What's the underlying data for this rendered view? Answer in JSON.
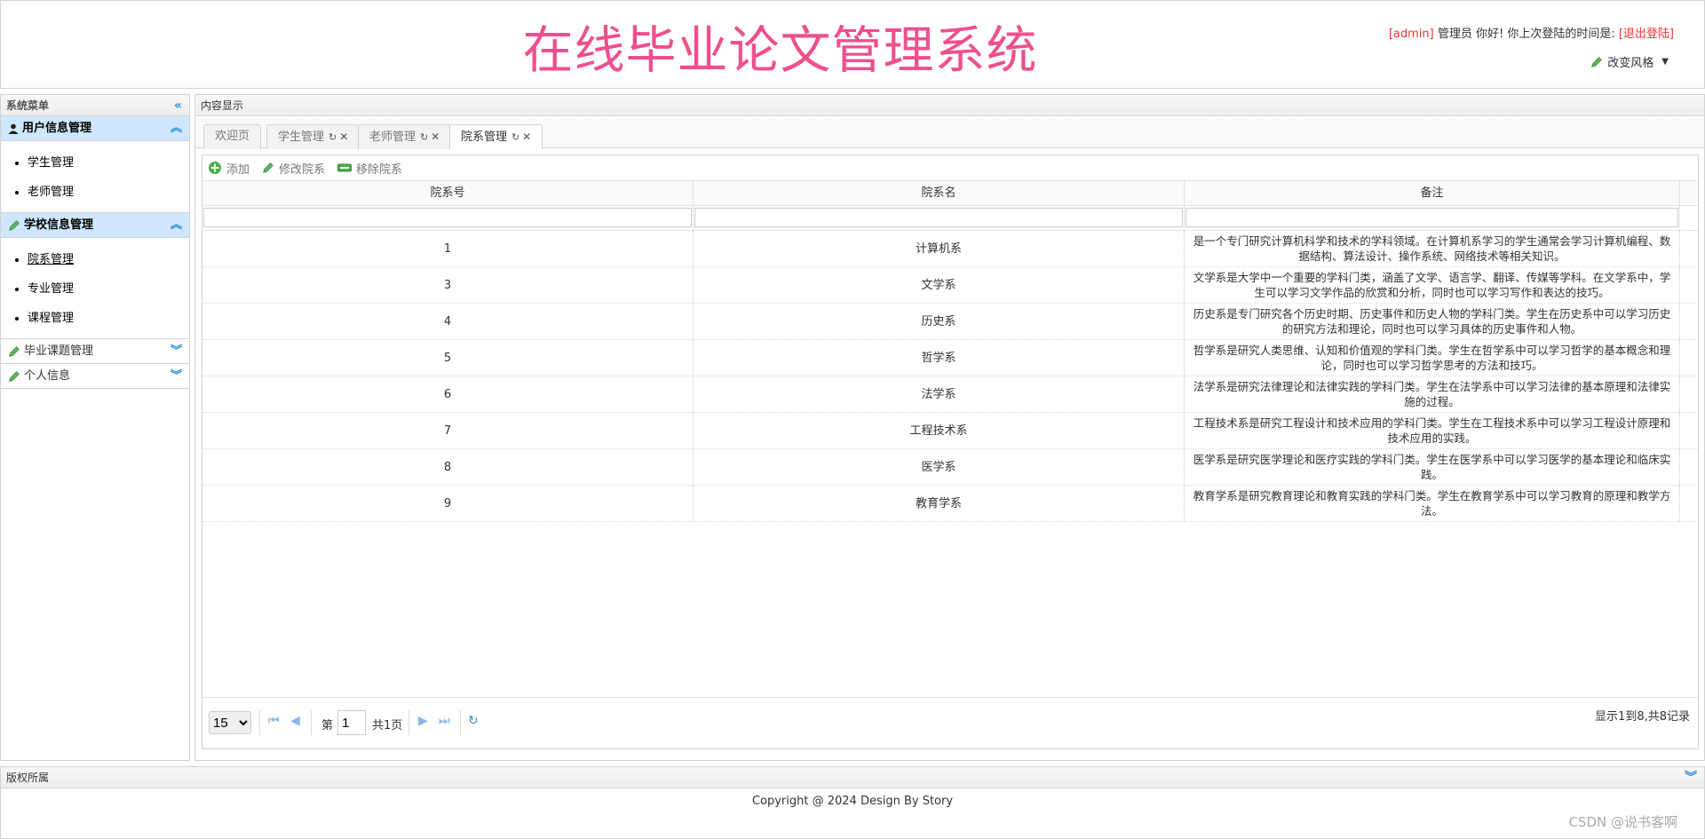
{
  "header": {
    "title": "在线毕业论文管理系统",
    "user_bracket": "[admin]",
    "role_greeting": " 管理员 你好! 你上次登陆的时间是: ",
    "logout": "[退出登陆]",
    "style_switch": "改变风格"
  },
  "west": {
    "title": "系统菜单",
    "groups": [
      {
        "label": "用户信息管理",
        "items": [
          "学生管理",
          "老师管理"
        ]
      },
      {
        "label": "学校信息管理",
        "items": [
          "院系管理",
          "专业管理",
          "课程管理"
        ]
      },
      {
        "label": "毕业课题管理"
      },
      {
        "label": "个人信息"
      }
    ]
  },
  "center": {
    "title": "内容显示",
    "tabs": [
      "欢迎页",
      "学生管理",
      "老师管理",
      "院系管理"
    ],
    "toolbar": {
      "add": "添加",
      "edit": "修改院系",
      "remove": "移除院系"
    },
    "columns": [
      "院系号",
      "院系名",
      "备注"
    ],
    "rows": [
      {
        "id": "1",
        "name": "计算机系",
        "note": "是一个专门研究计算机科学和技术的学科领域。在计算机系学习的学生通常会学习计算机编程、数据结构、算法设计、操作系统、网络技术等相关知识。"
      },
      {
        "id": "3",
        "name": "文学系",
        "note": "文学系是大学中一个重要的学科门类，涵盖了文学、语言学、翻译、传媒等学科。在文学系中，学生可以学习文学作品的欣赏和分析，同时也可以学习写作和表达的技巧。"
      },
      {
        "id": "4",
        "name": "历史系",
        "note": "历史系是专门研究各个历史时期、历史事件和历史人物的学科门类。学生在历史系中可以学习历史的研究方法和理论，同时也可以学习具体的历史事件和人物。"
      },
      {
        "id": "5",
        "name": "哲学系",
        "note": "哲学系是研究人类思维、认知和价值观的学科门类。学生在哲学系中可以学习哲学的基本概念和理论，同时也可以学习哲学思考的方法和技巧。"
      },
      {
        "id": "6",
        "name": "法学系",
        "note": "法学系是研究法律理论和法律实践的学科门类。学生在法学系中可以学习法律的基本原理和法律实施的过程。"
      },
      {
        "id": "7",
        "name": "工程技术系",
        "note": "工程技术系是研究工程设计和技术应用的学科门类。学生在工程技术系中可以学习工程设计原理和技术应用的实践。"
      },
      {
        "id": "8",
        "name": "医学系",
        "note": "医学系是研究医学理论和医疗实践的学科门类。学生在医学系中可以学习医学的基本理论和临床实践。"
      },
      {
        "id": "9",
        "name": "教育学系",
        "note": "教育学系是研究教育理论和教育实践的学科门类。学生在教育学系中可以学习教育的原理和教学方法。"
      }
    ],
    "pager": {
      "page_size": "15",
      "page_prefix": "第",
      "current_page": "1",
      "total_pages": "共1页",
      "info": "显示1到8,共8记录"
    }
  },
  "south": {
    "title": "版权所属",
    "copyright": "Copyright @ 2024 Design By Story",
    "watermark": "CSDN @说书客啊"
  },
  "colors": {
    "title_pink": "#ef4f8e",
    "accent_blue": "#2e8ed8",
    "selected_bg": "#cfe7fc",
    "logout_red": "#ee3333"
  }
}
